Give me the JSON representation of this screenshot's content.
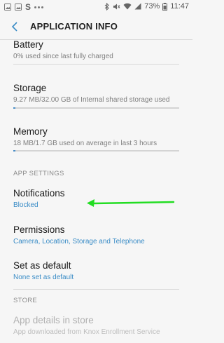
{
  "status_bar": {
    "left_icons": [
      "image-icon",
      "image-icon",
      "samsung-s-icon",
      "more-dots"
    ],
    "right_icons": [
      "bluetooth-icon",
      "mute-icon",
      "wifi-icon",
      "signal-icon"
    ],
    "battery": "73%",
    "time": "11:47"
  },
  "header": {
    "title": "APPLICATION INFO"
  },
  "items": {
    "battery": {
      "title": "Battery",
      "subtitle": "0% used since last fully charged"
    },
    "storage": {
      "title": "Storage",
      "subtitle": "9.27 MB/32.00 GB of Internal shared storage used",
      "usage_fraction": 0.0003
    },
    "memory": {
      "title": "Memory",
      "subtitle": "18 MB/1.7 GB used on average in last 3 hours",
      "usage_fraction": 0.01
    }
  },
  "sections": {
    "app_settings": "APP SETTINGS",
    "store": "STORE"
  },
  "settings": {
    "notifications": {
      "title": "Notifications",
      "subtitle": "Blocked"
    },
    "permissions": {
      "title": "Permissions",
      "subtitle": "Camera, Location, Storage and Telephone"
    },
    "set_default": {
      "title": "Set as default",
      "subtitle": "None set as default"
    }
  },
  "store": {
    "app_details": {
      "title": "App details in store",
      "subtitle": "App downloaded from Knox Enrollment Service"
    }
  },
  "colors": {
    "accent": "#3a8cc6",
    "annotation": "#22dd22"
  }
}
